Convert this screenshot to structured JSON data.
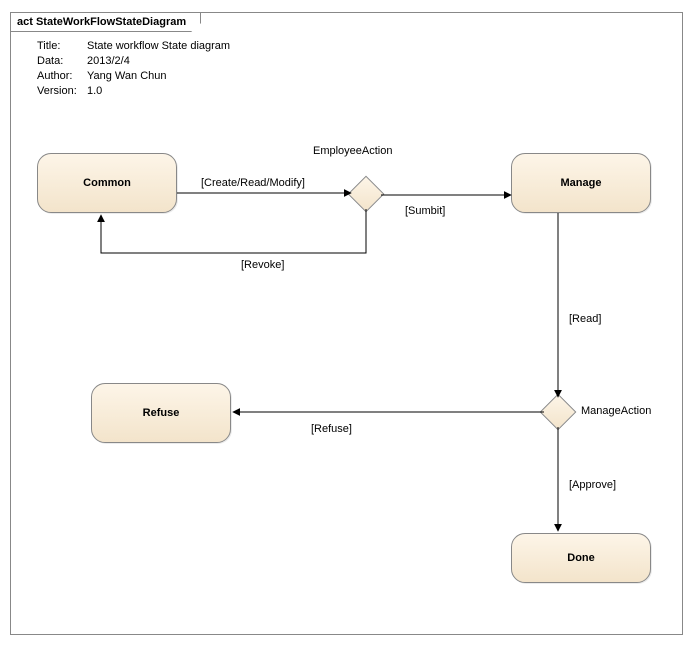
{
  "panel": {
    "tab": "act StateWorkFlowStateDiagram"
  },
  "meta": {
    "title_label": "Title:",
    "title_value": "State workflow State diagram",
    "data_label": "Data:",
    "data_value": "2013/2/4",
    "author_label": "Author:",
    "author_value": "Yang Wan Chun",
    "version_label": "Version:",
    "version_value": "1.0"
  },
  "states": {
    "common": "Common",
    "manage": "Manage",
    "refuse": "Refuse",
    "done": "Done"
  },
  "decisions": {
    "employee": "EmployeeAction",
    "manage": "ManageAction"
  },
  "edges": {
    "create_read_modify": "[Create/Read/Modify]",
    "submit": "[Sumbit]",
    "revoke": "[Revoke]",
    "read": "[Read]",
    "refuse": "[Refuse]",
    "approve": "[Approve]"
  },
  "diagram_data": {
    "type": "state_diagram",
    "states": [
      "Common",
      "Manage",
      "Refuse",
      "Done"
    ],
    "decision_nodes": [
      "EmployeeAction",
      "ManageAction"
    ],
    "transitions": [
      {
        "from": "Common",
        "to": "EmployeeAction",
        "guard": "Create/Read/Modify"
      },
      {
        "from": "EmployeeAction",
        "to": "Manage",
        "guard": "Sumbit"
      },
      {
        "from": "EmployeeAction",
        "to": "Common",
        "guard": "Revoke"
      },
      {
        "from": "Manage",
        "to": "ManageAction",
        "guard": "Read"
      },
      {
        "from": "ManageAction",
        "to": "Refuse",
        "guard": "Refuse"
      },
      {
        "from": "ManageAction",
        "to": "Done",
        "guard": "Approve"
      }
    ]
  }
}
